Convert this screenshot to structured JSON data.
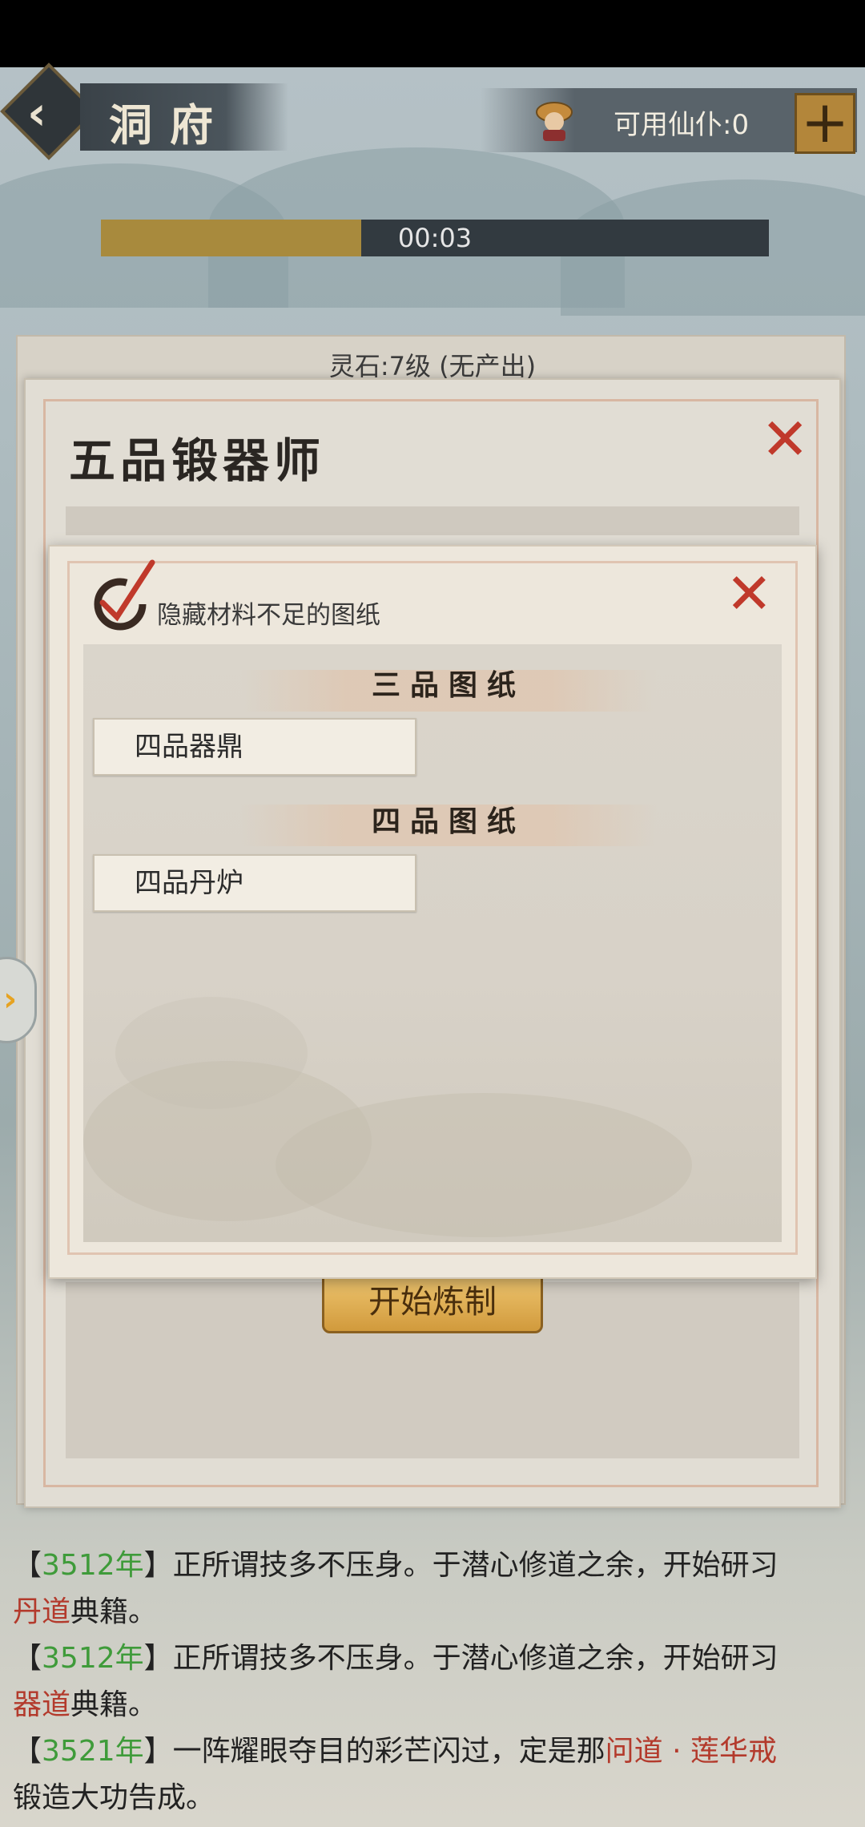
{
  "header": {
    "title": "洞府",
    "available_servants": "可用仙仆:0",
    "plus_label": "+"
  },
  "progress": {
    "time": "00:03",
    "fraction": 0.39
  },
  "background_panel": {
    "spirit_stone": "灵石:7级 (无产出)",
    "title": "五品锻器师",
    "start_button": "开始炼制"
  },
  "dialog": {
    "hide_label": "隐藏材料不足的图纸",
    "sections": [
      {
        "title": "三品图纸",
        "items": [
          "四品器鼎"
        ]
      },
      {
        "title": "四品图纸",
        "items": [
          "四品丹炉"
        ]
      }
    ]
  },
  "log": {
    "line1": {
      "open": "【",
      "year": "3512年",
      "close": "】",
      "text": "正所谓技多不压身。于潜心修道之余，开始研习"
    },
    "line1b": {
      "red": "丹道",
      "rest": "典籍。"
    },
    "line2": {
      "open": "【",
      "year": "3512年",
      "close": "】",
      "text": "正所谓技多不压身。于潜心修道之余，开始研习"
    },
    "line2b": {
      "red": "器道",
      "rest": "典籍。"
    },
    "line3": {
      "open": "【",
      "year": "3521年",
      "close": "】",
      "text": "一阵耀眼夺目的彩芒闪过，定是那",
      "red": "问道 · 莲华戒"
    },
    "line3b": {
      "rest": "锻造大功告成。"
    }
  },
  "colors": {
    "accent_gold": "#a88a3d",
    "year_green": "#3f9b3a",
    "highlight_red": "#b33a2c",
    "close_red": "#c0392b"
  },
  "icons": [
    "back-chevron-icon",
    "servant-hat-icon",
    "plus-icon",
    "close-icon",
    "check-brush-icon",
    "side-arrow-icon"
  ]
}
